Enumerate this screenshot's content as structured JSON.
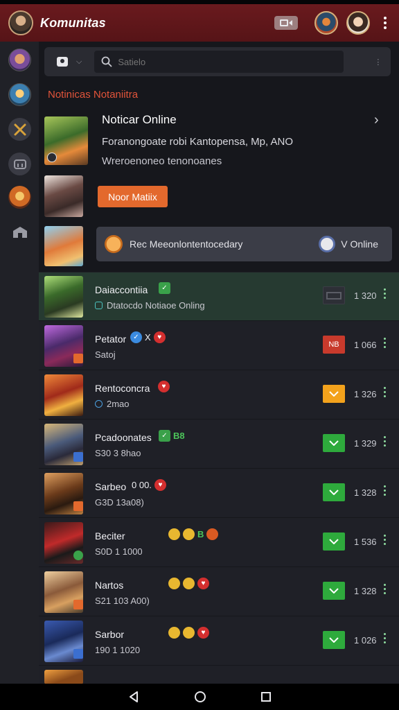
{
  "app": {
    "title": "Komunitas"
  },
  "search": {
    "placeholder": "Satielo"
  },
  "section": {
    "title": "Notinicas Notaniitra"
  },
  "notice": {
    "heading": "Noticar Online",
    "line1": "Foranongoate robi Kantopensa, Mp, ANO",
    "line2": "Wreroenoneo tenonoanes",
    "button": "Noor Matiix",
    "card_text": "Rec Meeonlontentocedary",
    "card_status": "V Online"
  },
  "rows": [
    {
      "name": "Daiaccontiia",
      "sub": "Dtatocdo Notiaoe Onling",
      "count": "1 320",
      "status": "dark",
      "active": true
    },
    {
      "name": "Petator",
      "extra": "X",
      "sub": "Satoj",
      "count": "1 066",
      "status": "red",
      "status_text": "NB"
    },
    {
      "name": "Rentoconcra",
      "sub": "2mao",
      "count": "1 326",
      "status": "orange"
    },
    {
      "name": "Pcadoonates",
      "extra_green": "B8",
      "sub": "S30 3 8hao",
      "count": "1 329",
      "status": "green"
    },
    {
      "name": "Sarbeo",
      "extra": "0 00.",
      "sub": "G3D 13a08)",
      "count": "1 328",
      "status": "green"
    },
    {
      "name": "Beciter",
      "extra": "B",
      "sub": "S0D 1 1000",
      "count": "1 536",
      "status": "green"
    },
    {
      "name": "Nartos",
      "sub": "S21 103 A00)",
      "count": "1 328",
      "status": "green"
    },
    {
      "name": "Sarbor",
      "sub": "190 1 1020",
      "count": "1 026",
      "status": "green"
    }
  ],
  "icons": {
    "rail": [
      "user-avatar",
      "game-avatar",
      "crossed-swords-icon",
      "controller-icon",
      "guild-avatar",
      "store-icon"
    ],
    "nav": [
      "back-icon",
      "home-icon",
      "recents-icon"
    ]
  },
  "colors": {
    "accent": "#e3692d",
    "appbar": "#5e171a",
    "online": "#2eaa3c",
    "section": "#e2543a"
  }
}
